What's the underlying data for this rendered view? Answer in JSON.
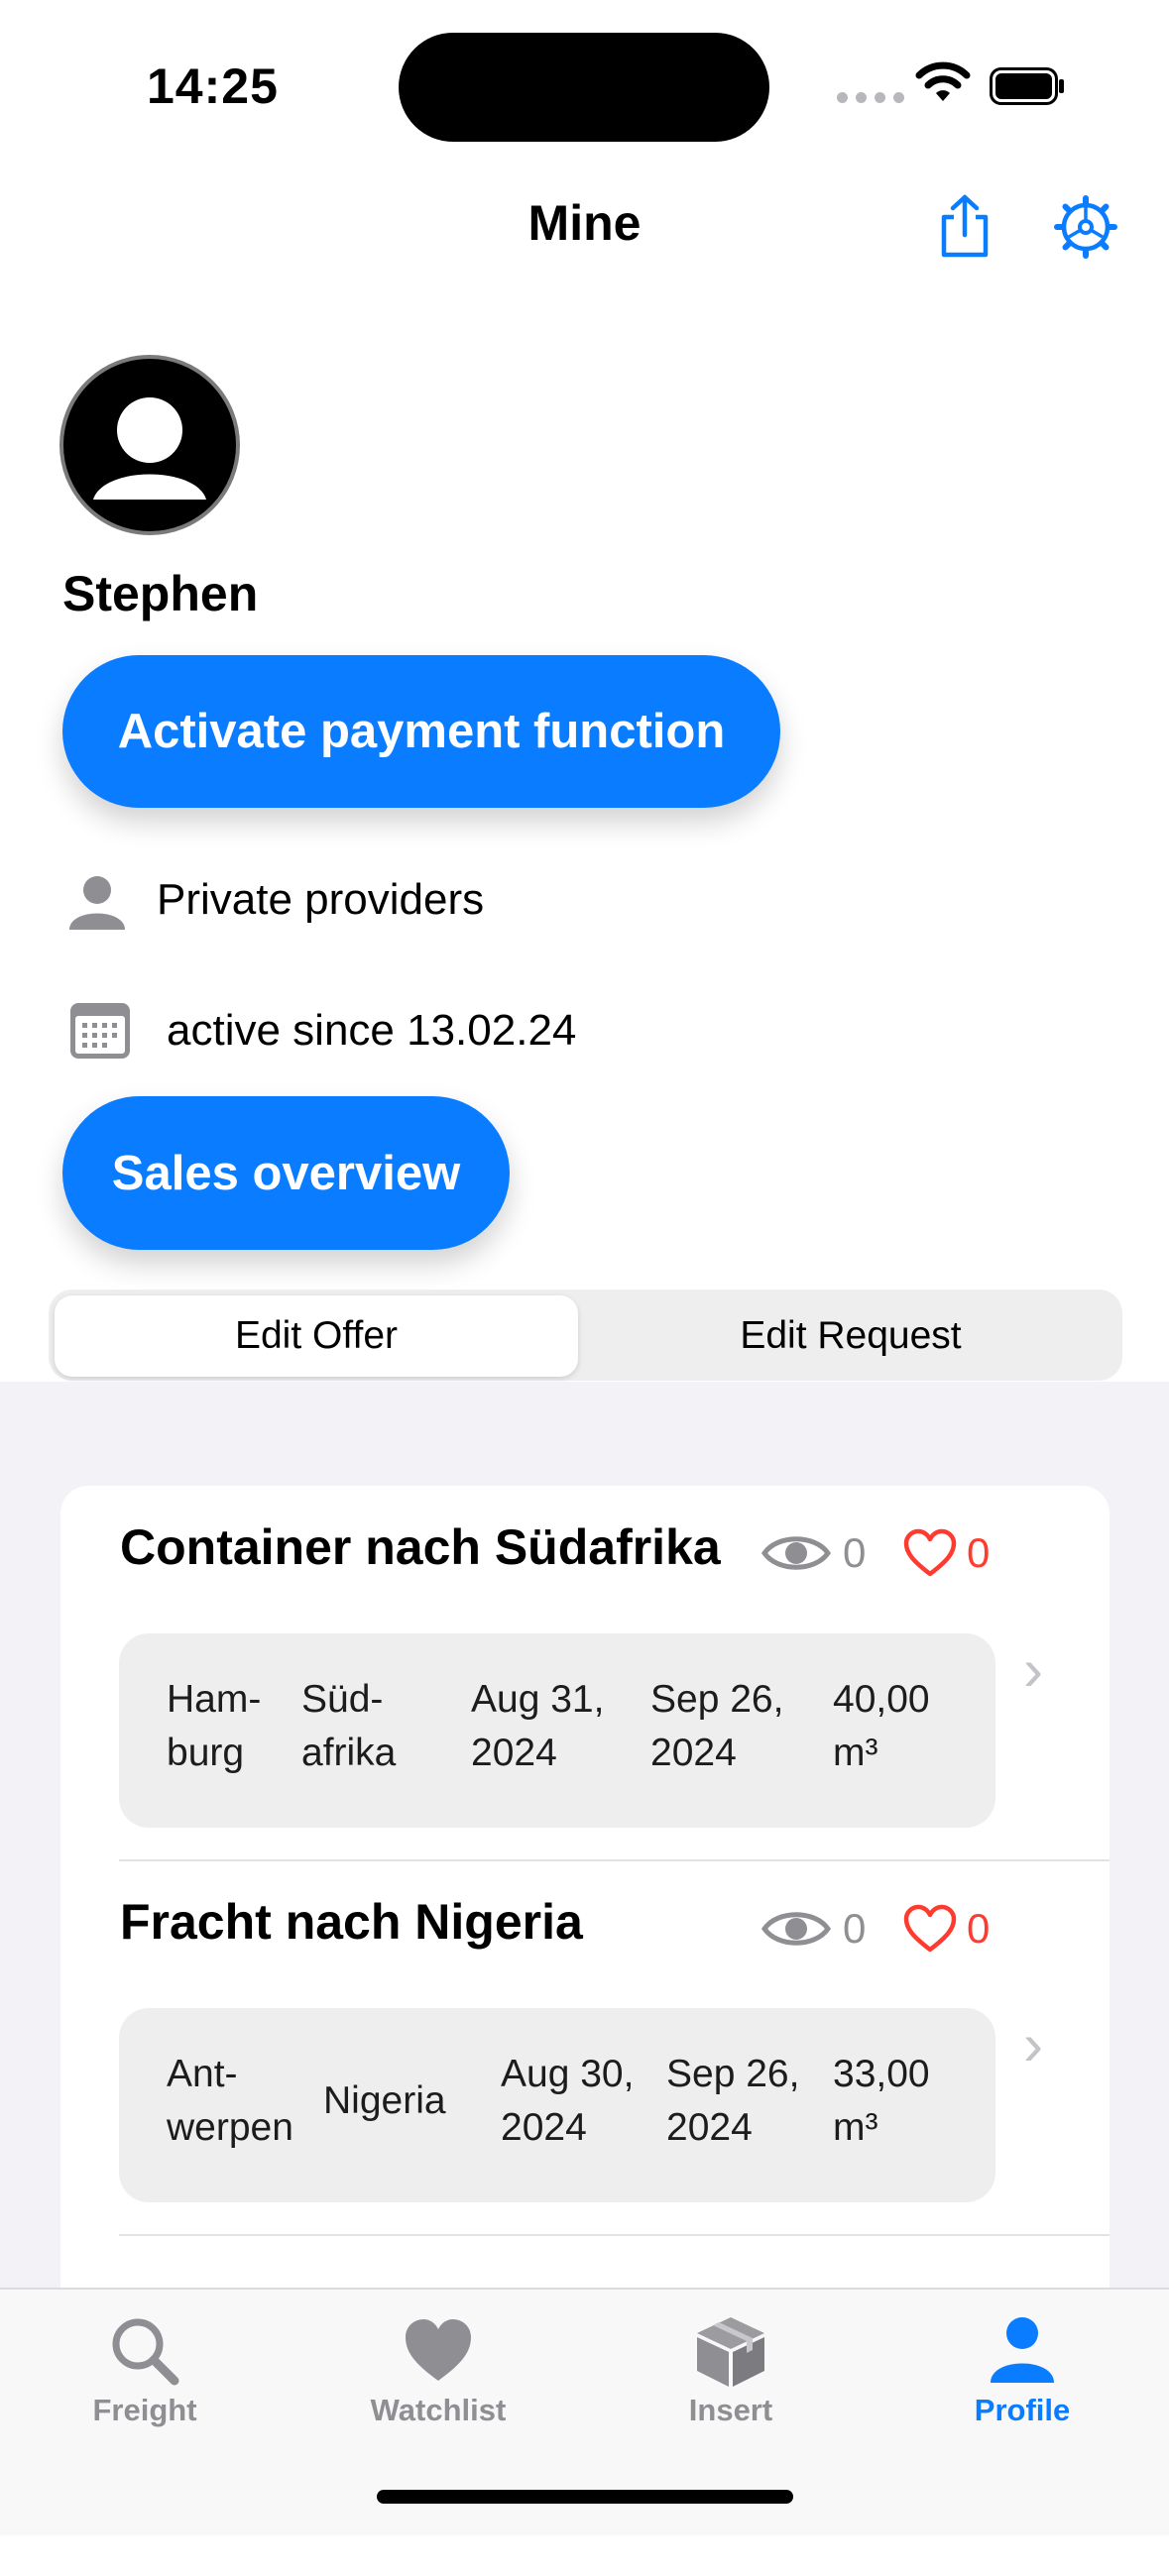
{
  "status_bar": {
    "time": "14:25"
  },
  "nav": {
    "title": "Mine",
    "share_icon": "share-icon",
    "settings_icon": "gear-icon",
    "accent": "#0a7cff"
  },
  "profile": {
    "name": "Stephen",
    "activate_label": "Activate payment function",
    "provider_type": "Private providers",
    "active_since": "active since 13.02.24",
    "sales_label": "Sales overview"
  },
  "segments": [
    {
      "label": "Edit Offer",
      "selected": true
    },
    {
      "label": "Edit Request",
      "selected": false
    }
  ],
  "offers": [
    {
      "title": "Container nach Südafrika",
      "views": "0",
      "likes": "0",
      "from": [
        "Ham-",
        "burg"
      ],
      "to": [
        "Süd-",
        "afrika"
      ],
      "start": [
        "Aug 31,",
        "2024"
      ],
      "end": [
        "Sep 26,",
        "2024"
      ],
      "volume": [
        "40,00",
        "m³"
      ]
    },
    {
      "title": "Fracht nach Nigeria",
      "views": "0",
      "likes": "0",
      "from": [
        "Ant-",
        "werpen"
      ],
      "to": [
        "Nigeria"
      ],
      "start": [
        "Aug 30,",
        "2024"
      ],
      "end": [
        "Sep 26,",
        "2024"
      ],
      "volume": [
        "33,00",
        "m³"
      ]
    }
  ],
  "tabs": [
    {
      "label": "Freight",
      "icon": "magnifier-icon"
    },
    {
      "label": "Watchlist",
      "icon": "heart-icon"
    },
    {
      "label": "Insert",
      "icon": "box-icon"
    },
    {
      "label": "Profile",
      "icon": "person-icon",
      "active": true
    }
  ]
}
